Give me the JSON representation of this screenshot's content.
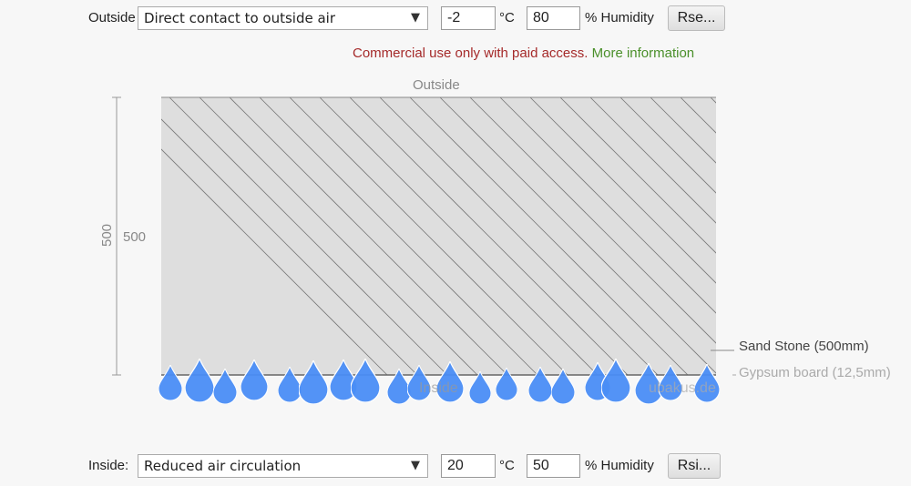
{
  "outside": {
    "label": "Outside",
    "select": "Direct contact to outside air",
    "temp": "-2",
    "temp_unit": "°C",
    "humidity": "80",
    "humidity_label": "% Humidity",
    "button": "Rse..."
  },
  "notice": {
    "text": "Commercial use only with paid access.",
    "link": "More information",
    "text_color": "#a52a2a",
    "link_color": "#4a8f2a"
  },
  "diagram": {
    "top_label": "Outside",
    "bottom_label": "Inside",
    "watermark": "ubakus.de",
    "dimension": "500",
    "layers": [
      "Sand Stone (500mm)",
      "Gypsum board (12,5mm)"
    ],
    "wall_fill": "#dedede",
    "drop_color": "#4a8df5",
    "drop_icon": "water-drop-icon"
  },
  "inside": {
    "label": "Inside:",
    "select": "Reduced air circulation",
    "temp": "20",
    "temp_unit": "°C",
    "humidity": "50",
    "humidity_label": "% Humidity",
    "button": "Rsi..."
  }
}
